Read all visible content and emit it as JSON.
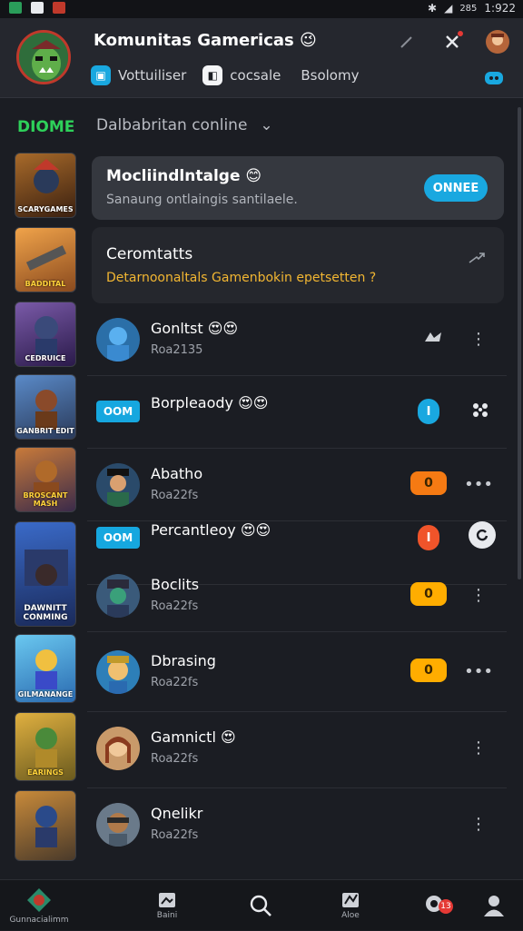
{
  "status_bar": {
    "time": "1:922",
    "battery": "285"
  },
  "header": {
    "title": "Komunitas Gamericas",
    "title_emoji": "😉",
    "chips": [
      {
        "icon": "chat-icon",
        "label": "Vottuiliser"
      },
      {
        "icon": "gamepad-icon",
        "label": "cocsale"
      },
      {
        "icon": "",
        "label": "Bsolomy"
      }
    ]
  },
  "sidebar": {
    "title": "DIOME",
    "thumbnails": [
      {
        "caption": "SCARYGAMES",
        "color": "#6b4a1e"
      },
      {
        "caption": "BADDITAL",
        "color": "#d9822b"
      },
      {
        "caption": "CEDRUICE",
        "color": "#5a3f7a"
      },
      {
        "caption": "GANBRIT EDIT",
        "color": "#3a5a86"
      },
      {
        "caption": "BROSCANT MASH",
        "color": "#8a4a1e"
      },
      {
        "caption": "DAWNITT CONMING",
        "color": "#2f4c8a"
      },
      {
        "caption": "GILMANANGE",
        "color": "#2a7ab0"
      },
      {
        "caption": "EARINGS",
        "color": "#7a6a1e"
      },
      {
        "caption": "",
        "color": "#5a4a2a"
      }
    ]
  },
  "main": {
    "dropdown": "Dalbabritan conline",
    "card_online": {
      "title": "Mocliindlntalge",
      "emoji": "😊",
      "subtitle": "Sanaung ontlaingis santilaele.",
      "button": "ONNEE"
    },
    "card_notice": {
      "title": "Ceromtatts",
      "subtitle": "Detarnoonaltals Gamenbokin epetsetten ?"
    },
    "rows": [
      {
        "name": "Gonltst",
        "emoji": "😍😍",
        "sub": "Roa2135",
        "kind": "avatar",
        "avatar_color": "#2b6fa8",
        "action": "",
        "action_style": "",
        "more": "⋮",
        "extra_icon": "controller-icon"
      },
      {
        "name": "Borpleaody",
        "emoji": "😍😍",
        "sub": "",
        "kind": "badge",
        "badge": "OOM",
        "action": "I",
        "action_style": "blue",
        "more": "",
        "extra_icon": "users-icon"
      },
      {
        "name": "Abatho",
        "emoji": "",
        "sub": "Roa22fs",
        "kind": "avatar",
        "avatar_color": "#2a4a6a",
        "action": "0",
        "action_style": "orange",
        "more": "•••",
        "extra_icon": ""
      },
      {
        "name": "Percantleoy",
        "emoji": "😍😍",
        "sub": "",
        "kind": "badge",
        "badge": "OOM",
        "action": "I",
        "action_style": "red",
        "more": "",
        "extra_icon": "refresh-icon"
      },
      {
        "name": "Boclits",
        "emoji": "",
        "sub": "Roa22fs",
        "kind": "avatar",
        "avatar_color": "#3a5a7a",
        "action": "0",
        "action_style": "yellow",
        "more": "⋮",
        "extra_icon": ""
      },
      {
        "name": "Dbrasing",
        "emoji": "",
        "sub": "Roa22fs",
        "kind": "avatar",
        "avatar_color": "#2d7fb8",
        "action": "0",
        "action_style": "yellow",
        "more": "•••",
        "extra_icon": ""
      },
      {
        "name": "Gamnictl",
        "emoji": "😍",
        "sub": "Roa22fs",
        "kind": "avatar",
        "avatar_color": "#c99a6a",
        "action": "",
        "action_style": "",
        "more": "⋮",
        "extra_icon": ""
      },
      {
        "name": "Qnelikr",
        "emoji": "",
        "sub": "Roa22fs",
        "kind": "avatar",
        "avatar_color": "#6a7a8a",
        "action": "",
        "action_style": "",
        "more": "⋮",
        "extra_icon": ""
      }
    ]
  },
  "bottom_nav": [
    {
      "icon": "game-logo-icon",
      "label": "Gunnacialimm"
    },
    {
      "icon": "book-icon",
      "label": "Baini"
    },
    {
      "icon": "search-icon",
      "label": ""
    },
    {
      "icon": "chart-icon",
      "label": "Aloe"
    },
    {
      "icon": "settings-icon",
      "label": "",
      "badge": "13"
    },
    {
      "icon": "profile-icon",
      "label": ""
    }
  ],
  "colors": {
    "accent_blue": "#19a8e0",
    "accent_green": "#2ed15a",
    "accent_yellow": "#ffad00",
    "accent_orange": "#f57a13"
  }
}
